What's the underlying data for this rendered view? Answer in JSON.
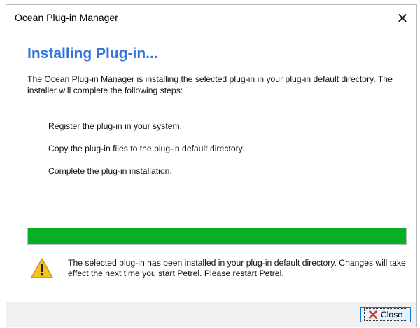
{
  "window": {
    "title": "Ocean Plug-in Manager",
    "close_glyph": "✕"
  },
  "content": {
    "heading": "Installing Plug-in...",
    "intro": "The Ocean Plug-in Manager is installing the selected plug-in in your plug-in default directory. The installer will complete the following steps:",
    "steps": [
      "Register the plug-in in your system.",
      "Copy the plug-in files to the plug-in default directory.",
      "Complete the plug-in installation."
    ],
    "progress": {
      "percent": 100,
      "color": "#06b025"
    },
    "message": {
      "icon": "warning-icon",
      "text": "The selected plug-in has been installed in your plug-in default directory. Changes will take effect the next time you start Petrel. Please restart Petrel."
    }
  },
  "footer": {
    "close_label": "Close",
    "close_icon": "red-x-icon"
  },
  "colors": {
    "heading": "#3474dc",
    "accent": "#0078d7"
  }
}
